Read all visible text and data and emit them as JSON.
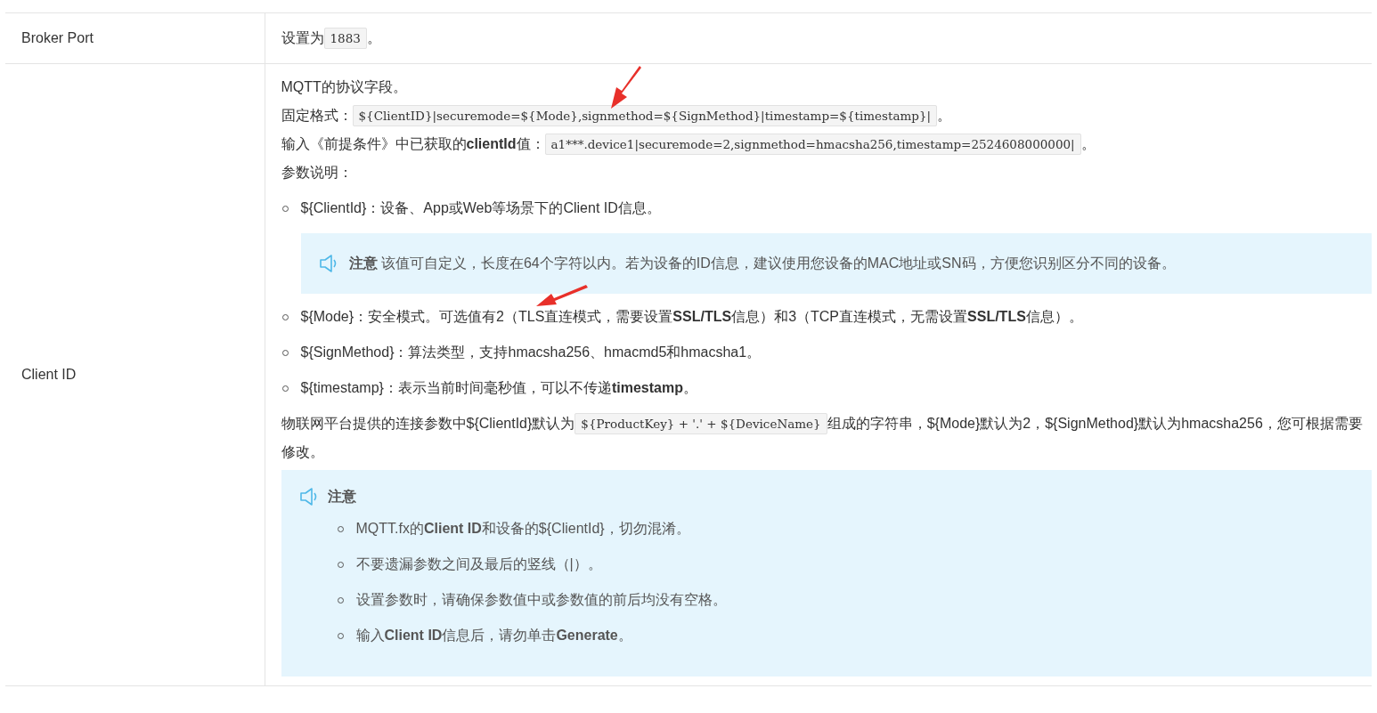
{
  "rows": [
    {
      "label": "Broker Port",
      "content": [
        {
          "kind": "para",
          "parts": [
            {
              "kind": "text",
              "text": "设置为"
            },
            {
              "kind": "code",
              "text": "1883"
            },
            {
              "kind": "text",
              "text": "。"
            }
          ]
        }
      ]
    },
    {
      "label": "Client ID",
      "content": [
        {
          "kind": "para",
          "parts": [
            {
              "kind": "text",
              "text": "MQTT的协议字段。"
            }
          ]
        },
        {
          "kind": "para",
          "parts": [
            {
              "kind": "text",
              "text": "固定格式："
            },
            {
              "kind": "code",
              "text": "${ClientID}|securemode=${Mode},signmethod=${SignMethod}|timestamp=${timestamp}|"
            },
            {
              "kind": "text",
              "text": "。"
            }
          ]
        },
        {
          "kind": "para",
          "parts": [
            {
              "kind": "text",
              "text": "输入《前提条件》中已获取的**clientId**值："
            },
            {
              "kind": "code",
              "text": "a1***.device1|securemode=2,signmethod=hmacsha256,timestamp=2524608000000|"
            },
            {
              "kind": "text",
              "text": "。"
            }
          ]
        },
        {
          "kind": "para",
          "parts": [
            {
              "kind": "text",
              "text": "参数说明："
            }
          ]
        },
        {
          "kind": "bullets",
          "items": [
            {
              "text": "${ClientId}：设备、App或Web等场景下的Client ID信息。",
              "note": {
                "title": "注意",
                "text": "该值可自定义，长度在64个字符以内。若为设备的ID信息，建议使用您设备的MAC地址或SN码，方便您识别区分不同的设备。"
              }
            },
            {
              "text": "${Mode}：安全模式。可选值有2（TLS直连模式，需要设置**SSL/TLS**信息）和3（TCP直连模式，无需设置**SSL/TLS**信息）。"
            },
            {
              "text": "${SignMethod}：算法类型，支持hmacsha256、hmacmd5和hmacsha1。"
            },
            {
              "text": "${timestamp}：表示当前时间毫秒值，可以不传递**timestamp**。"
            }
          ]
        },
        {
          "kind": "para",
          "parts": [
            {
              "kind": "text",
              "text": "物联网平台提供的连接参数中${ClientId}默认为"
            },
            {
              "kind": "code",
              "text": "${ProductKey} + '.' + ${DeviceName}"
            },
            {
              "kind": "text",
              "text": "组成的字符串，${Mode}默认为2，${SignMethod}默认为hmacsha256，您可根据需要修改。"
            }
          ]
        },
        {
          "kind": "note",
          "title": "注意",
          "items": [
            "MQTT.fx的**Client ID**和设备的${ClientId}，切勿混淆。",
            "不要遗漏参数之间及最后的竖线（|）。",
            "设置参数时，请确保参数值中或参数值的前后均没有空格。",
            "输入**Client ID**信息后，请勿单击**Generate**。"
          ]
        }
      ]
    }
  ]
}
